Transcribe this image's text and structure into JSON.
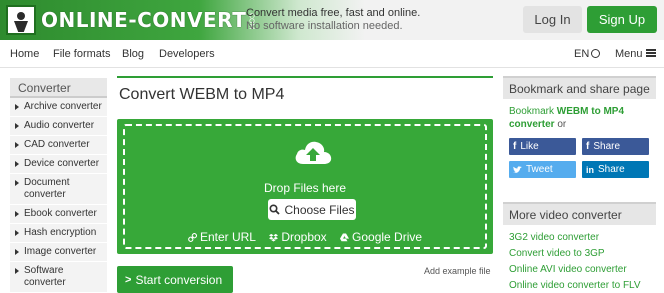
{
  "header": {
    "logo_text": "ONLINE-CONVERT",
    "logo_suffix": ".COM",
    "tagline_1": "Convert media free, fast and online.",
    "tagline_2": "No software installation needed.",
    "login_label": "Log In",
    "signup_label": "Sign Up"
  },
  "nav": {
    "items": [
      "Home",
      "File formats",
      "Blog",
      "Developers"
    ],
    "lang_label": "EN",
    "menu_label": "Menu"
  },
  "sidebar": {
    "title": "Converter",
    "items": [
      "Archive converter",
      "Audio converter",
      "CAD converter",
      "Device converter",
      "Document converter",
      "Ebook converter",
      "Hash encryption",
      "Image converter",
      "Software converter"
    ]
  },
  "main": {
    "title": "Convert WEBM to MP4",
    "drop_label": "Drop Files here",
    "choose_label": "Choose Files",
    "sources": [
      "Enter URL",
      "Dropbox",
      "Google Drive"
    ],
    "start_label": "Start conversion",
    "add_example": "Add example file"
  },
  "right": {
    "bookmark_title": "Bookmark and share page",
    "bookmark_prefix": "Bookmark ",
    "bookmark_bold": "WEBM to MP4 converter",
    "bookmark_or": " or",
    "share": [
      {
        "label": "Like",
        "color": "#3b5998"
      },
      {
        "label": "Share",
        "color": "#3b5998"
      },
      {
        "label": "Tweet",
        "color": "#55acee"
      },
      {
        "label": "Share",
        "color": "#0077b5"
      }
    ],
    "more_title": "More video converter",
    "more_links": [
      "3G2 video converter",
      "Convert video to 3GP",
      "Online AVI video converter",
      "Online video converter to FLV"
    ]
  },
  "colors": {
    "brand_green": "#2e9e35",
    "drop_green": "#37a839"
  }
}
